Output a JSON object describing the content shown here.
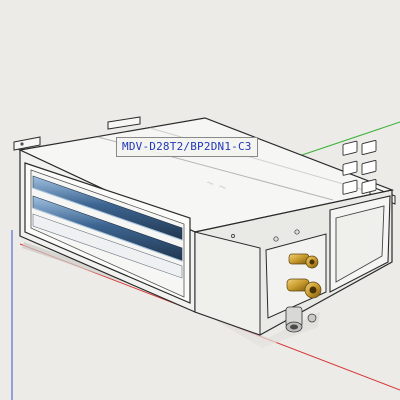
{
  "viewport": {
    "background": "#ecebe7",
    "axes": {
      "red": "#d63a3a",
      "green": "#38b138",
      "blue": "#3a55d6"
    }
  },
  "model": {
    "name": "ducted-indoor-unit",
    "tag_label": "MDV-D28T2/BP2DN1-C3",
    "tag_color": "#2238b8",
    "body_color": "#f3f3f1",
    "outline_color": "#2a2a2a",
    "louver_color": "#3a5c8c",
    "fitting_color": "#c79a2b"
  }
}
